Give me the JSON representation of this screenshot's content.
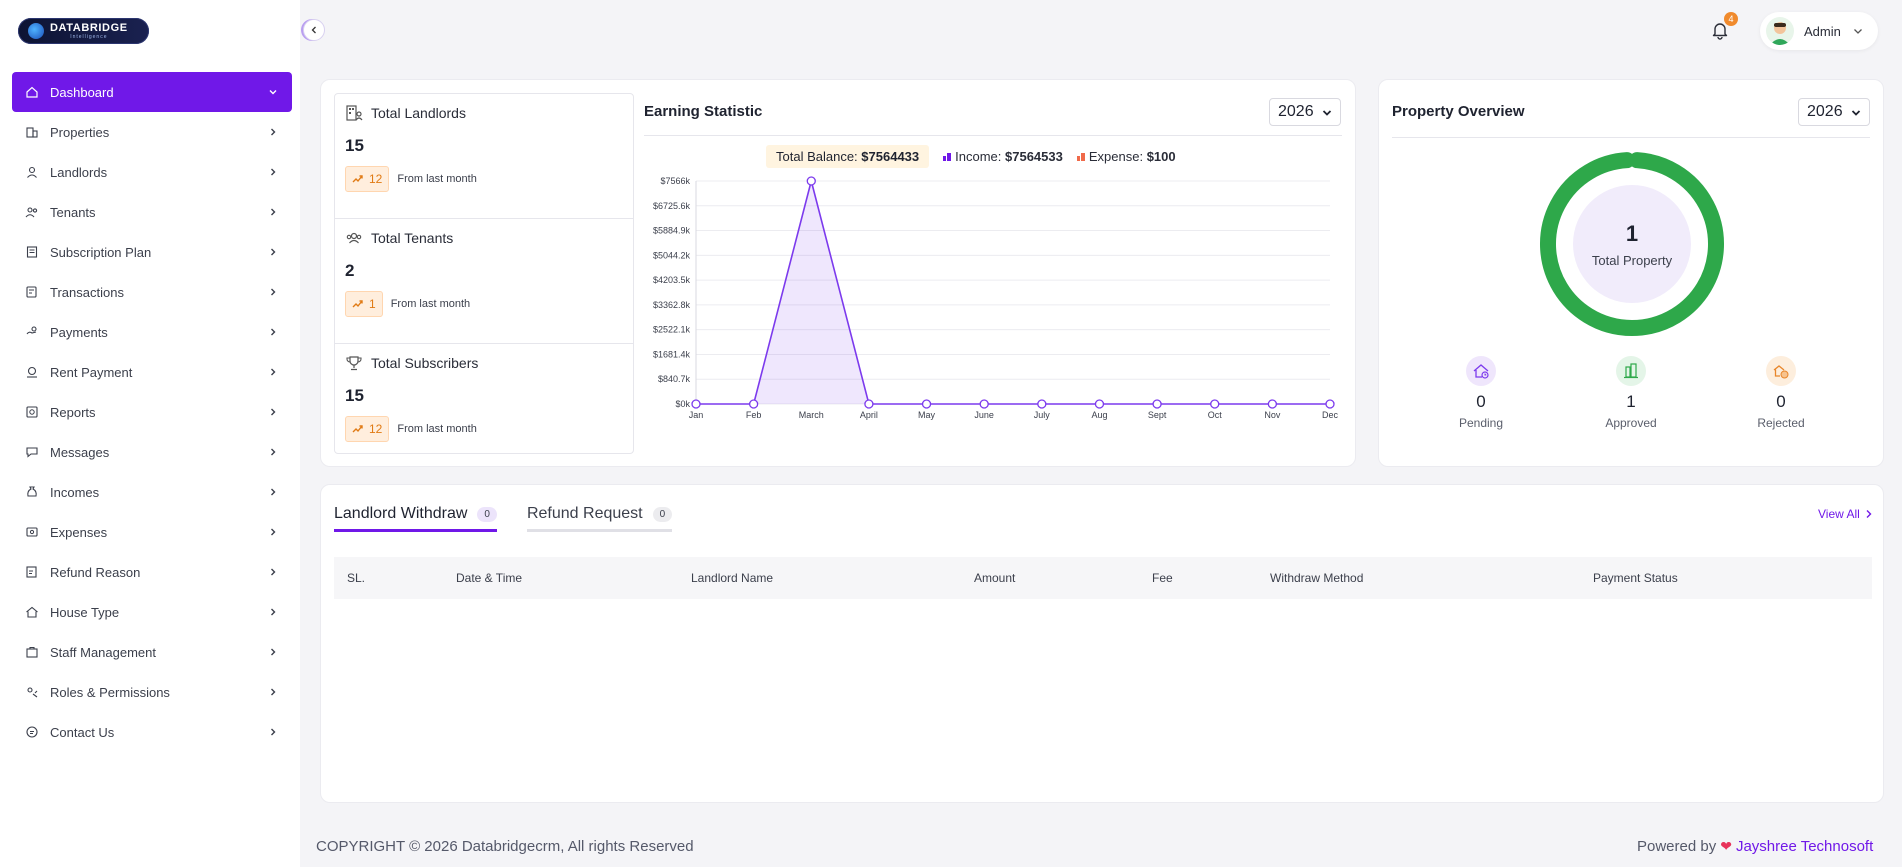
{
  "brand": {
    "logo_text": "DATABRIDGE",
    "logo_sub": "Intelligence"
  },
  "sidebar": {
    "items": [
      {
        "label": "Dashboard",
        "icon": "home-icon"
      },
      {
        "label": "Properties",
        "icon": "building-icon"
      },
      {
        "label": "Landlords",
        "icon": "user-icon"
      },
      {
        "label": "Tenants",
        "icon": "users-icon"
      },
      {
        "label": "Subscription Plan",
        "icon": "receipt-icon"
      },
      {
        "label": "Transactions",
        "icon": "transactions-icon"
      },
      {
        "label": "Payments",
        "icon": "payments-icon"
      },
      {
        "label": "Rent Payment",
        "icon": "coin-hand-icon"
      },
      {
        "label": "Reports",
        "icon": "report-icon"
      },
      {
        "label": "Messages",
        "icon": "chat-icon"
      },
      {
        "label": "Incomes",
        "icon": "money-bag-icon"
      },
      {
        "label": "Expenses",
        "icon": "expense-icon"
      },
      {
        "label": "Refund Reason",
        "icon": "refund-icon"
      },
      {
        "label": "House Type",
        "icon": "house-icon"
      },
      {
        "label": "Staff Management",
        "icon": "staff-icon"
      },
      {
        "label": "Roles & Permissions",
        "icon": "roles-icon"
      },
      {
        "label": "Contact Us",
        "icon": "contact-icon"
      }
    ]
  },
  "header": {
    "notification_count": "4",
    "user_name": "Admin"
  },
  "stats": [
    {
      "title": "Total Landlords",
      "value": "15",
      "trend": "12",
      "trend_text": "From last month"
    },
    {
      "title": "Total Tenants",
      "value": "2",
      "trend": "1",
      "trend_text": "From last month"
    },
    {
      "title": "Total Subscribers",
      "value": "15",
      "trend": "12",
      "trend_text": "From last month"
    }
  ],
  "earning": {
    "title": "Earning Statistic",
    "year": "2026",
    "balance_label": "Total Balance:",
    "balance_value": "$7564433",
    "income_label": "Income:",
    "income_value": "$7564533",
    "expense_label": "Expense:",
    "expense_value": "$100"
  },
  "chart_data": {
    "type": "area",
    "categories": [
      "Jan",
      "Feb",
      "March",
      "April",
      "May",
      "June",
      "July",
      "Aug",
      "Sept",
      "Oct",
      "Nov",
      "Dec"
    ],
    "y_ticks": [
      "$7566k",
      "$6725.6k",
      "$5884.9k",
      "$5044.2k",
      "$4203.5k",
      "$3362.8k",
      "$2522.1k",
      "$1681.4k",
      "$840.7k",
      "$0k"
    ],
    "ylim": [
      0,
      7566
    ],
    "series": [
      {
        "values": [
          0,
          0,
          7566,
          0,
          0,
          0,
          0,
          0,
          0,
          0,
          0,
          0
        ],
        "color": "#7c3aed"
      }
    ],
    "grid": true
  },
  "property": {
    "title": "Property Overview",
    "year": "2026",
    "total_value": "1",
    "total_label": "Total Property",
    "donut_fraction": 1,
    "stats": [
      {
        "value": "0",
        "label": "Pending",
        "icon": "house-clock-icon",
        "color": "#7c3aed"
      },
      {
        "value": "1",
        "label": "Approved",
        "icon": "buildings-icon",
        "color": "#2ea84a"
      },
      {
        "value": "0",
        "label": "Rejected",
        "icon": "house-coin-icon",
        "color": "#e8862a"
      }
    ]
  },
  "tabs": [
    {
      "label": "Landlord Withdraw",
      "count": "0"
    },
    {
      "label": "Refund Request",
      "count": "0"
    }
  ],
  "view_all": "View All",
  "table": {
    "columns": [
      "SL.",
      "Date & Time",
      "Landlord Name",
      "Amount",
      "Fee",
      "Withdraw Method",
      "Payment Status"
    ]
  },
  "footer": {
    "copyright": "COPYRIGHT © 2026 Databridgecrm, All rights Reserved",
    "powered_by": "Powered by",
    "company": "Jayshree Technosoft"
  },
  "colors": {
    "accent": "#7018e8",
    "donut": "#2ea84a"
  }
}
